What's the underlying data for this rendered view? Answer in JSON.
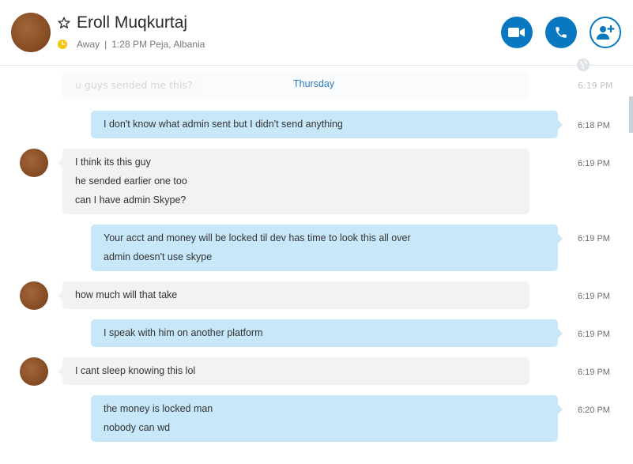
{
  "header": {
    "contact_name": "Eroll Muqkurtaj",
    "status": "Away",
    "separator": "|",
    "local_info": "1:28 PM Peja, Albania",
    "buttons": [
      "video-call",
      "audio-call",
      "add-people"
    ]
  },
  "colors": {
    "accent": "#0a78c0",
    "outgoing_bubble": "#c8e7f8",
    "incoming_bubble": "#f1f2f4",
    "away_status": "#f8c50d"
  },
  "chat": {
    "faded_message": "u guys sended me this?",
    "faded_time": "6:19 PM",
    "day_label": "Thursday",
    "messages": [
      {
        "dir": "out",
        "lines": [
          "I don't know what admin sent but I didn't send anything"
        ],
        "time": "6:18 PM"
      },
      {
        "dir": "in",
        "lines": [
          "I think its this guy",
          "he sended earlier one too",
          "can I have admin Skype?"
        ],
        "time": "6:19 PM"
      },
      {
        "dir": "out",
        "lines": [
          "Your acct and money will be locked til dev has time to look this all over",
          "admin doesn't use skype"
        ],
        "time": "6:19 PM"
      },
      {
        "dir": "in",
        "lines": [
          "how much will that take"
        ],
        "time": "6:19 PM"
      },
      {
        "dir": "out",
        "lines": [
          "I speak with him on another platform"
        ],
        "time": "6:19 PM"
      },
      {
        "dir": "in",
        "lines": [
          "I cant sleep knowing this lol"
        ],
        "time": "6:19 PM"
      },
      {
        "dir": "out",
        "lines": [
          "the money is locked man",
          "nobody can wd"
        ],
        "time": "6:20 PM"
      }
    ]
  }
}
